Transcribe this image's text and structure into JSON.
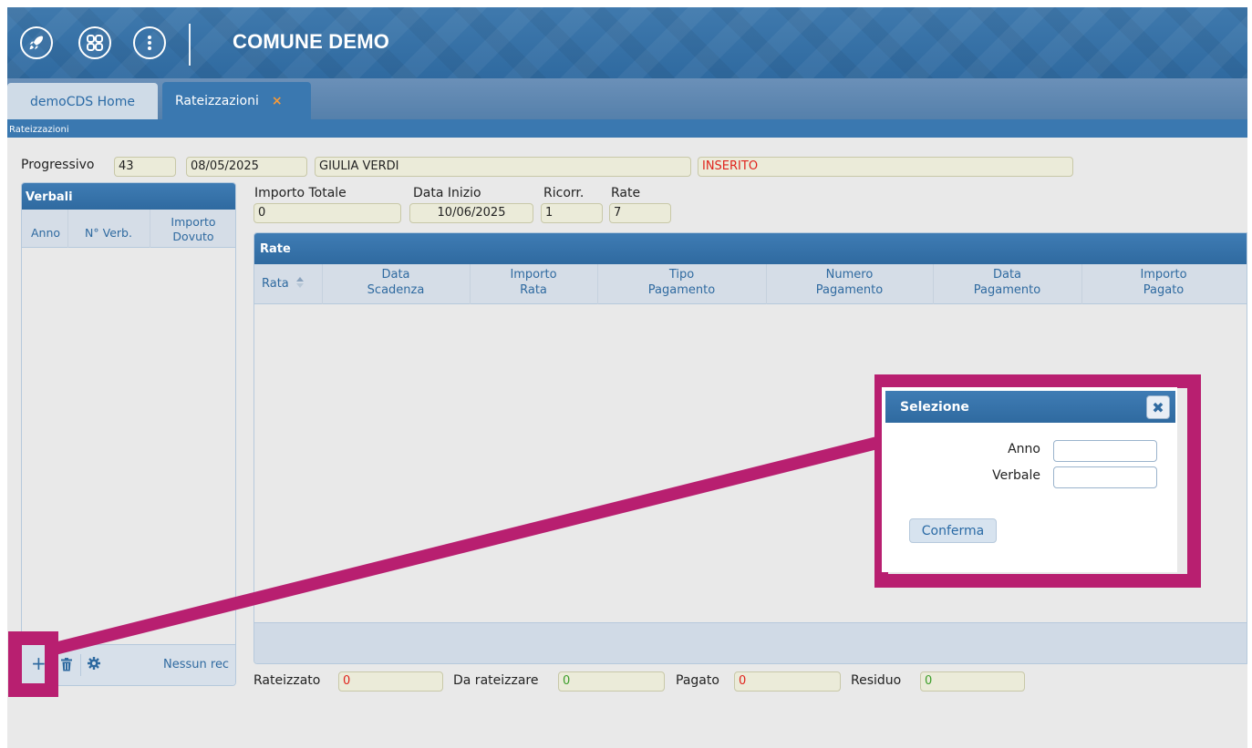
{
  "header": {
    "title": "COMUNE DEMO",
    "icons": [
      "rocket-icon",
      "apps-grid-icon",
      "more-vertical-icon"
    ]
  },
  "tabs": [
    {
      "label": "demoCDS Home"
    },
    {
      "label": "Rateizzazioni",
      "close": "×"
    }
  ],
  "breadcrumb": "Rateizzazioni",
  "form": {
    "progressivo_label": "Progressivo",
    "progressivo_value": "43",
    "date_value": "08/05/2025",
    "name_value": "GIULIA VERDI",
    "status_value": "INSERITO",
    "importo_totale_label": "Importo Totale",
    "importo_totale_value": "0",
    "data_inizio_label": "Data Inizio",
    "data_inizio_value": "10/06/2025",
    "ricorr_label": "Ricorr.",
    "ricorr_value": "1",
    "rate_label": "Rate",
    "rate_value": "7"
  },
  "verbali": {
    "title": "Verbali",
    "columns": {
      "anno": "Anno",
      "num": "N° Verb.",
      "importo_1": "Importo",
      "importo_2": "Dovuto"
    },
    "footer_text": "Nessun rec"
  },
  "rate_grid": {
    "title": "Rate",
    "columns": [
      {
        "line1": "Rata",
        "line2": ""
      },
      {
        "line1": "Data",
        "line2": "Scadenza"
      },
      {
        "line1": "Importo",
        "line2": "Rata"
      },
      {
        "line1": "Tipo",
        "line2": "Pagamento"
      },
      {
        "line1": "Numero",
        "line2": "Pagamento"
      },
      {
        "line1": "Data",
        "line2": "Pagamento"
      },
      {
        "line1": "Importo",
        "line2": "Pagato"
      }
    ]
  },
  "totals": {
    "rateizzato_label": "Rateizzato",
    "rateizzato_value": "0",
    "da_rateizzare_label": "Da rateizzare",
    "da_rateizzare_value": "0",
    "pagato_label": "Pagato",
    "pagato_value": "0",
    "residuo_label": "Residuo",
    "residuo_value": "0"
  },
  "dialog": {
    "title": "Selezione",
    "close": "✖",
    "anno_label": "Anno",
    "verbale_label": "Verbale",
    "confirm_label": "Conferma"
  },
  "colors": {
    "brand_blue": "#2f6aa0",
    "highlight": "#b81f70",
    "status_red": "#e0231d",
    "value_green": "#3c9e2a"
  }
}
